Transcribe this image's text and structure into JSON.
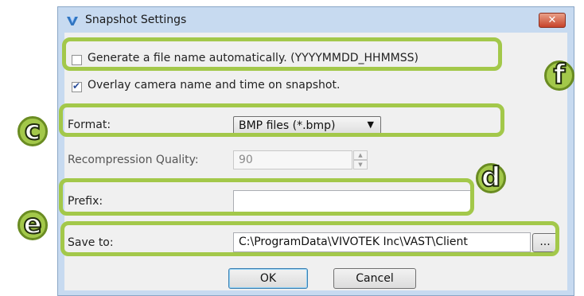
{
  "window": {
    "title": "Snapshot Settings",
    "close_glyph": "✕"
  },
  "options": {
    "auto_filename_label": "Generate a file name automatically. (YYYYMMDD_HHMMSS)",
    "auto_filename_checked": false,
    "overlay_label": "Overlay camera name and time on snapshot.",
    "overlay_checked": true
  },
  "format": {
    "label": "Format:",
    "value": "BMP files (*.bmp)",
    "arrow_glyph": "▼"
  },
  "quality": {
    "label": "Recompression Quality:",
    "value": "90",
    "up_glyph": "▲",
    "down_glyph": "▼"
  },
  "prefix": {
    "label": "Prefix:",
    "value": ""
  },
  "save_to": {
    "label": "Save to:",
    "value": "C:\\ProgramData\\VIVOTEK Inc\\VAST\\Client",
    "browse_label": "..."
  },
  "buttons": {
    "ok": "OK",
    "cancel": "Cancel"
  },
  "callouts": {
    "c": "c",
    "d": "d",
    "e": "e",
    "f": "f"
  },
  "colors": {
    "highlight": "#a3c84a",
    "window_frame": "#c7daf0",
    "close_button": "#c7432a"
  }
}
